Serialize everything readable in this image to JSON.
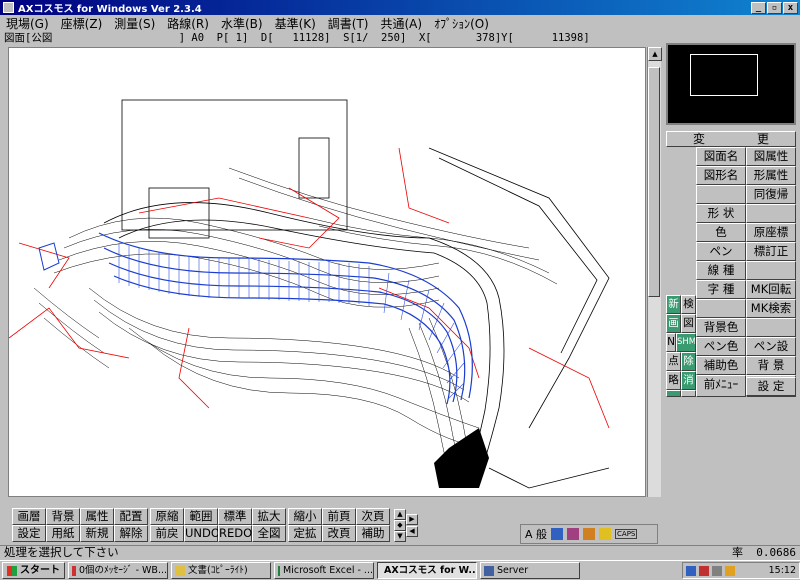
{
  "window": {
    "title": "AXコスモス for Windows Ver 2.3.4",
    "buttons": [
      "_",
      "▫",
      "x"
    ]
  },
  "menu": [
    "現場(G)",
    "座標(Z)",
    "測量(S)",
    "路線(R)",
    "水準(B)",
    "基準(K)",
    "調書(T)",
    "共通(A)",
    "ｵﾌﾟｼｮﾝ(O)"
  ],
  "status_line": "図面[公図                    ] A0  P[ 1]  D[   11128]  S[1/  250]  X[       378]Y[      11398]",
  "right_panel": {
    "header_left": "変",
    "header_right": "更",
    "col_b": [
      "図面名",
      "図形名",
      "",
      "形 状",
      "色",
      "ペン",
      "線 種",
      "字 種",
      "",
      "背景色",
      "ペン色",
      "補助色",
      "",
      "前ﾒﾆｭｰ"
    ],
    "col_c": [
      "図属性",
      "形属性",
      "同復帰",
      "",
      "原座標",
      "標訂正",
      "",
      "MK回転",
      "MK検索",
      "",
      "ペン設",
      "",
      "背 景",
      "前 景",
      "設 定"
    ],
    "col_a": [
      {
        "text": "新",
        "green": true
      },
      {
        "text": "検",
        "green": false
      },
      {
        "text": "画",
        "green": true
      },
      {
        "text": "図",
        "green": false
      },
      {
        "text": "N",
        "green": false
      },
      {
        "text": "SHM",
        "green": true
      },
      {
        "text": "点",
        "green": false
      },
      {
        "text": "除",
        "green": true
      },
      {
        "text": "略",
        "green": false
      },
      {
        "text": "消",
        "green": true
      },
      {
        "text": "通",
        "green": true
      },
      {
        "text": "補",
        "green": false
      }
    ]
  },
  "bottom_buttons": {
    "row1": [
      "画層",
      "背景",
      "属性",
      "配置",
      "原縮",
      "範囲",
      "標準",
      "拡大",
      "縮小",
      "前頁",
      "次頁"
    ],
    "row2": [
      "設定",
      "用紙",
      "新規",
      "解除",
      "前戻",
      "UNDO",
      "REDO",
      "全図",
      "定拡",
      "改頁",
      "補助"
    ]
  },
  "toolstrip": {
    "label": "A 般",
    "caps": "CAPS"
  },
  "prompt": {
    "text": "処理を選択して下さい",
    "ratio_label": "率",
    "ratio_value": "0.0686"
  },
  "taskbar": {
    "start": "スタート",
    "tasks": [
      {
        "label": "0個のﾒｯｾｰｼﾞ - WB...",
        "active": false,
        "color": "#d03030"
      },
      {
        "label": "文書(ｺﾋﾟｰﾗｲﾄ)",
        "active": false,
        "color": "#e0c040"
      },
      {
        "label": "Microsoft Excel - ...",
        "active": false,
        "color": "#208040"
      },
      {
        "label": "AXコスモス for W...",
        "active": true,
        "color": "#d02020"
      },
      {
        "label": "Server",
        "active": false,
        "color": "#4060a0"
      }
    ],
    "clock": "15:12"
  }
}
